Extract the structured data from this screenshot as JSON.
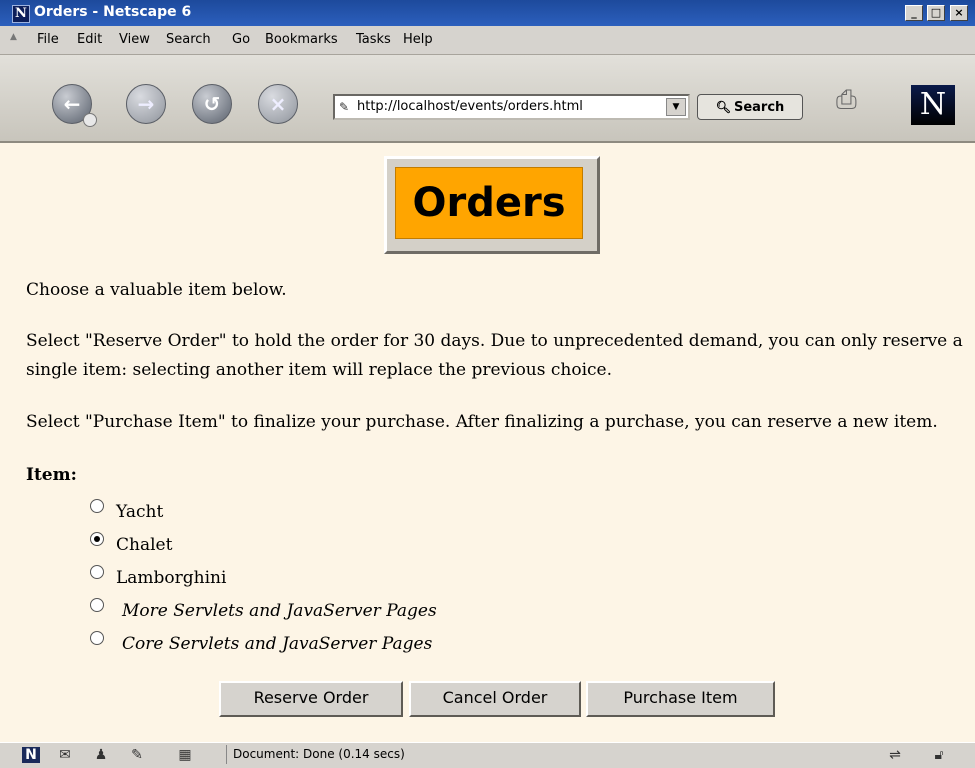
{
  "window": {
    "title": "Orders - Netscape 6",
    "logo_letter": "N",
    "controls": [
      "_",
      "□",
      "×"
    ]
  },
  "menubar": {
    "items": [
      "File",
      "Edit",
      "View",
      "Search",
      "Go",
      "Bookmarks",
      "Tasks",
      "Help"
    ]
  },
  "toolbar": {
    "nav_icons": [
      "back-icon",
      "forward-icon",
      "reload-icon",
      "stop-icon"
    ],
    "url": "http://localhost/events/orders.html",
    "search_label": "Search",
    "brand_letter": "N"
  },
  "page": {
    "banner": "Orders",
    "intro": "Choose a valuable item below.",
    "reserve_text": "Select \"Reserve Order\" to hold the order for 30 days. Due to unprecedented demand, you can only reserve a single item: selecting another item will replace the previous choice.",
    "purchase_text": "Select \"Purchase Item\" to finalize your purchase. After finalizing a purchase, you can reserve a new item.",
    "item_label": "Item:",
    "items": [
      {
        "label": "Yacht",
        "selected": false,
        "italic": false
      },
      {
        "label": "Chalet",
        "selected": true,
        "italic": false
      },
      {
        "label": "Lamborghini",
        "selected": false,
        "italic": false
      },
      {
        "label": "More Servlets and JavaServer Pages",
        "selected": false,
        "italic": true
      },
      {
        "label": "Core Servlets and JavaServer Pages",
        "selected": false,
        "italic": true
      }
    ],
    "buttons": {
      "reserve": "Reserve Order",
      "cancel": "Cancel Order",
      "purchase": "Purchase Item"
    }
  },
  "statusbar": {
    "text": "Document: Done (0.14 secs)"
  }
}
